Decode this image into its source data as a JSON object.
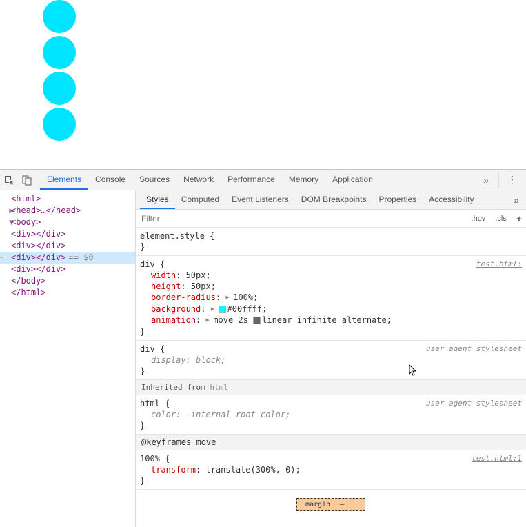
{
  "topbar": {
    "tabs": [
      "Elements",
      "Console",
      "Sources",
      "Network",
      "Performance",
      "Memory",
      "Application"
    ],
    "active_tab": "Elements"
  },
  "dom": {
    "lines": [
      {
        "indent": 0,
        "tri": "",
        "text": "<html>",
        "sel": false
      },
      {
        "indent": 1,
        "tri": "▶",
        "text": "<head>…</head>",
        "sel": false
      },
      {
        "indent": 1,
        "tri": "▼",
        "text": "<body>",
        "sel": false
      },
      {
        "indent": 2,
        "tri": "",
        "text": "<div></div>",
        "sel": false
      },
      {
        "indent": 2,
        "tri": "",
        "text": "<div></div>",
        "sel": false
      },
      {
        "indent": 2,
        "tri": "",
        "text": "<div></div>",
        "sel": true,
        "eq": "== $0"
      },
      {
        "indent": 2,
        "tri": "",
        "text": "<div></div>",
        "sel": false
      },
      {
        "indent": 1,
        "tri": "",
        "text": "</body>",
        "sel": false
      },
      {
        "indent": 0,
        "tri": "",
        "text": "</html>",
        "sel": false
      }
    ]
  },
  "subtabs": {
    "tabs": [
      "Styles",
      "Computed",
      "Event Listeners",
      "DOM Breakpoints",
      "Properties",
      "Accessibility"
    ],
    "active": "Styles"
  },
  "filter": {
    "placeholder": "Filter",
    "hov": ":hov",
    "cls": ".cls",
    "plus": "+"
  },
  "rules": {
    "element_style": {
      "selector": "element.style",
      "open": "{",
      "close": "}"
    },
    "div_rule": {
      "selector": "div",
      "source": "test.html:",
      "props": [
        {
          "name": "width",
          "val": "50px"
        },
        {
          "name": "height",
          "val": "50px"
        },
        {
          "name": "border-radius",
          "exp": true,
          "val": "100%"
        },
        {
          "name": "background",
          "exp": true,
          "swatch": "cyan",
          "val": "#00ffff"
        },
        {
          "name": "animation",
          "exp": true,
          "val_pre": "move 2s ",
          "swatch2": "grey",
          "val_post": "linear infinite alternate"
        }
      ]
    },
    "div_ua": {
      "selector": "div",
      "source": "user agent stylesheet",
      "props": [
        {
          "name": "display",
          "val": "block",
          "italic": true
        }
      ]
    },
    "inherited_label": "Inherited from ",
    "inherited_el": "html",
    "html_ua": {
      "selector": "html",
      "source": "user agent stylesheet",
      "props": [
        {
          "name": "color",
          "val": "-internal-root-color",
          "italic": true
        }
      ]
    },
    "keyframes_header": "@keyframes move",
    "keyframes_rule": {
      "selector": "100%",
      "source": "test.html:1",
      "props": [
        {
          "name": "transform",
          "val": "translate(300%, 0)"
        }
      ]
    }
  },
  "boxmodel": {
    "margin_label": "margin",
    "dash": "–"
  }
}
